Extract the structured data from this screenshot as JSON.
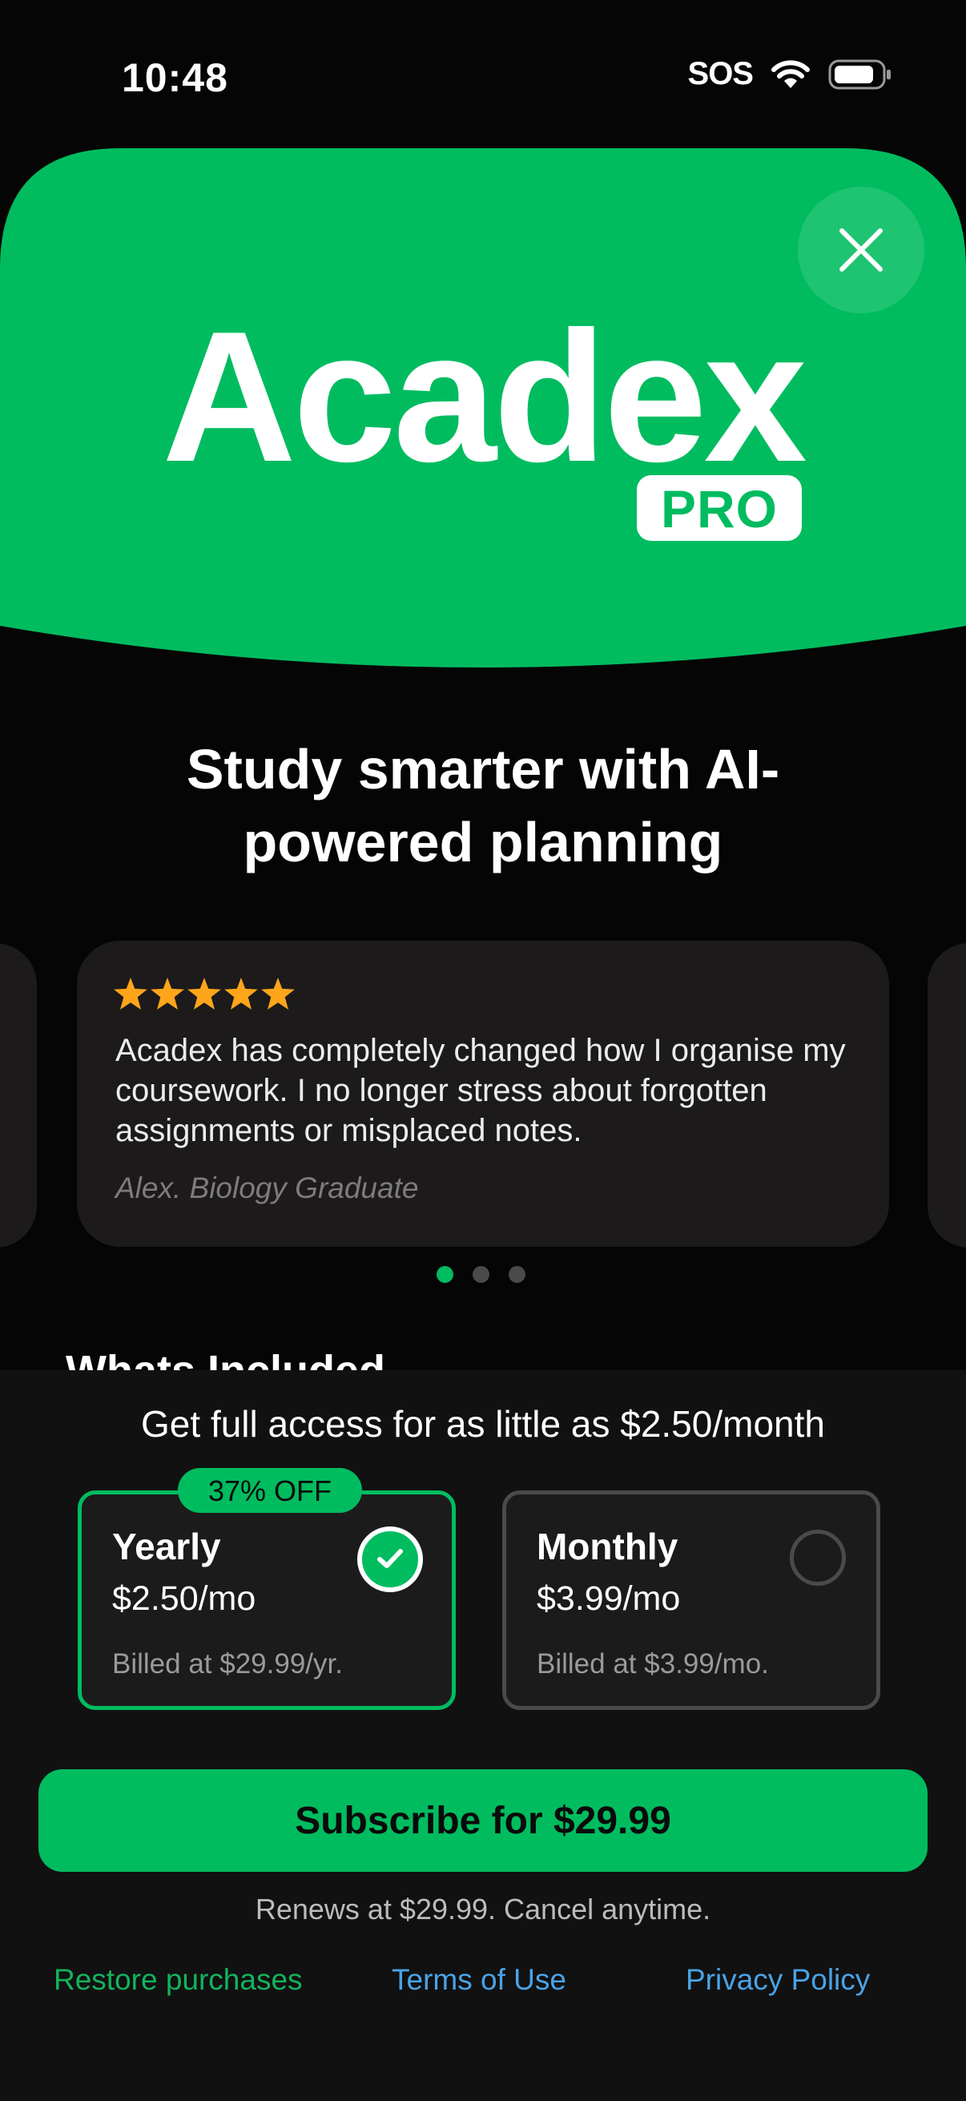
{
  "status_bar": {
    "time": "10:48",
    "carrier_label": "SOS",
    "icons": [
      "wifi-icon",
      "battery-icon"
    ]
  },
  "hero": {
    "app_name": "Acadex",
    "badge": "PRO",
    "close_icon": "close-icon",
    "brand_color": "#00bc5f"
  },
  "headline": "Study smarter with AI-powered planning",
  "testimonials": {
    "active_index": 0,
    "count": 3,
    "rating": 5,
    "star_color": "#ffa51a",
    "active_card": {
      "text": "Acadex has completely changed how I organise my coursework. I no longer stress about forgotten assignments or misplaced notes.",
      "author": "Alex. Biology Graduate"
    }
  },
  "section_peek": "Whats Included",
  "paywall": {
    "access_text": "Get full access for as little as $2.50/month",
    "plans": [
      {
        "name": "Yearly",
        "price": "$2.50/mo",
        "billed": "Billed at $29.99/yr.",
        "badge": "37% OFF",
        "selected": true
      },
      {
        "name": "Monthly",
        "price": "$3.99/mo",
        "billed": "Billed at $3.99/mo.",
        "selected": false
      }
    ],
    "subscribe_label": "Subscribe for $29.99",
    "renews_text": "Renews at $29.99. Cancel anytime.",
    "links": {
      "restore": "Restore purchases",
      "terms": "Terms of Use",
      "privacy": "Privacy Policy"
    }
  }
}
